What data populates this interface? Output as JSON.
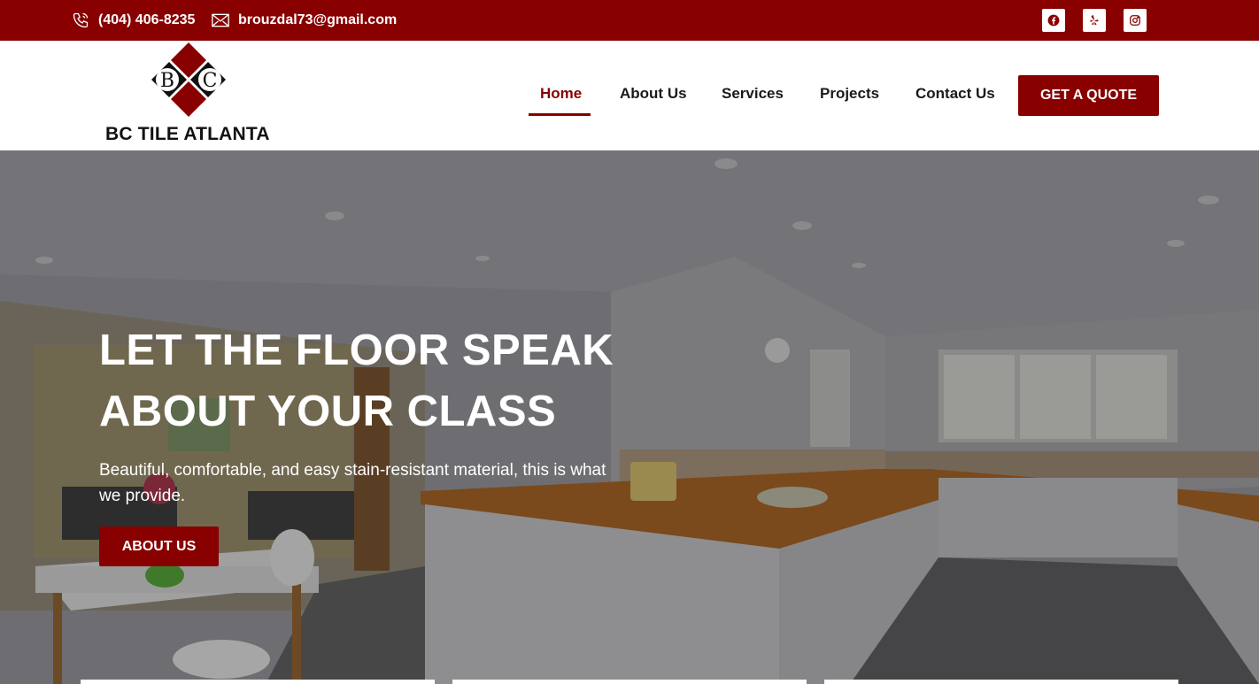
{
  "topbar": {
    "phone": "(404) 406-8235",
    "email": "brouzdal73@gmail.com",
    "phone_icon": "phone-icon",
    "email_icon": "envelope-icon",
    "social": [
      "facebook-icon",
      "yelp-icon",
      "instagram-icon"
    ]
  },
  "header": {
    "logo_letters": [
      "B",
      "C"
    ],
    "logo_text": "BC TILE ATLANTA",
    "nav": {
      "home": "Home",
      "about": "About Us",
      "services": "Services",
      "projects": "Projects",
      "contact": "Contact Us"
    },
    "quote_button": "GET A QUOTE"
  },
  "hero": {
    "title": "LET THE FLOOR SPEAK ABOUT YOUR CLASS",
    "subtitle": "Beautiful, comfortable, and easy stain-resistant material, this is what we provide.",
    "button": "ABOUT US"
  },
  "colors": {
    "brand": "#880000",
    "text_dark": "#1a1a1a",
    "white": "#ffffff"
  }
}
